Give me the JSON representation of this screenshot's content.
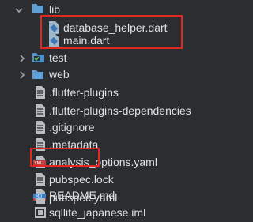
{
  "tree": {
    "items": [
      {
        "label": "lib",
        "icon": "folder-icon",
        "expanded": true
      },
      {
        "label": "database_helper.dart",
        "icon": "dart-file-icon"
      },
      {
        "label": "main.dart",
        "icon": "dart-file-icon"
      },
      {
        "label": "test",
        "icon": "test-folder-icon",
        "expanded": false
      },
      {
        "label": "web",
        "icon": "folder-icon",
        "expanded": false
      },
      {
        "label": ".flutter-plugins",
        "icon": "text-file-icon"
      },
      {
        "label": ".flutter-plugins-dependencies",
        "icon": "text-file-icon"
      },
      {
        "label": ".gitignore",
        "icon": "text-file-icon"
      },
      {
        "label": ".metadata",
        "icon": "text-file-icon"
      },
      {
        "label": "analysis_options.yaml",
        "icon": "yaml-file-icon"
      },
      {
        "label": "pubspec.lock",
        "icon": "text-file-icon"
      },
      {
        "label": "pubspec.yaml",
        "icon": "yaml-file-icon"
      },
      {
        "label": "README.md",
        "icon": "markdown-file-icon"
      },
      {
        "label": "sqllite_japanese.iml",
        "icon": "iml-file-icon"
      }
    ]
  },
  "colors": {
    "background": "#2b2d30",
    "text": "#dfe1e5",
    "folder": "#5f9fd8",
    "dart": "#9fb8cc",
    "highlight": "#e0281f",
    "yaml": "#c43b3b"
  }
}
